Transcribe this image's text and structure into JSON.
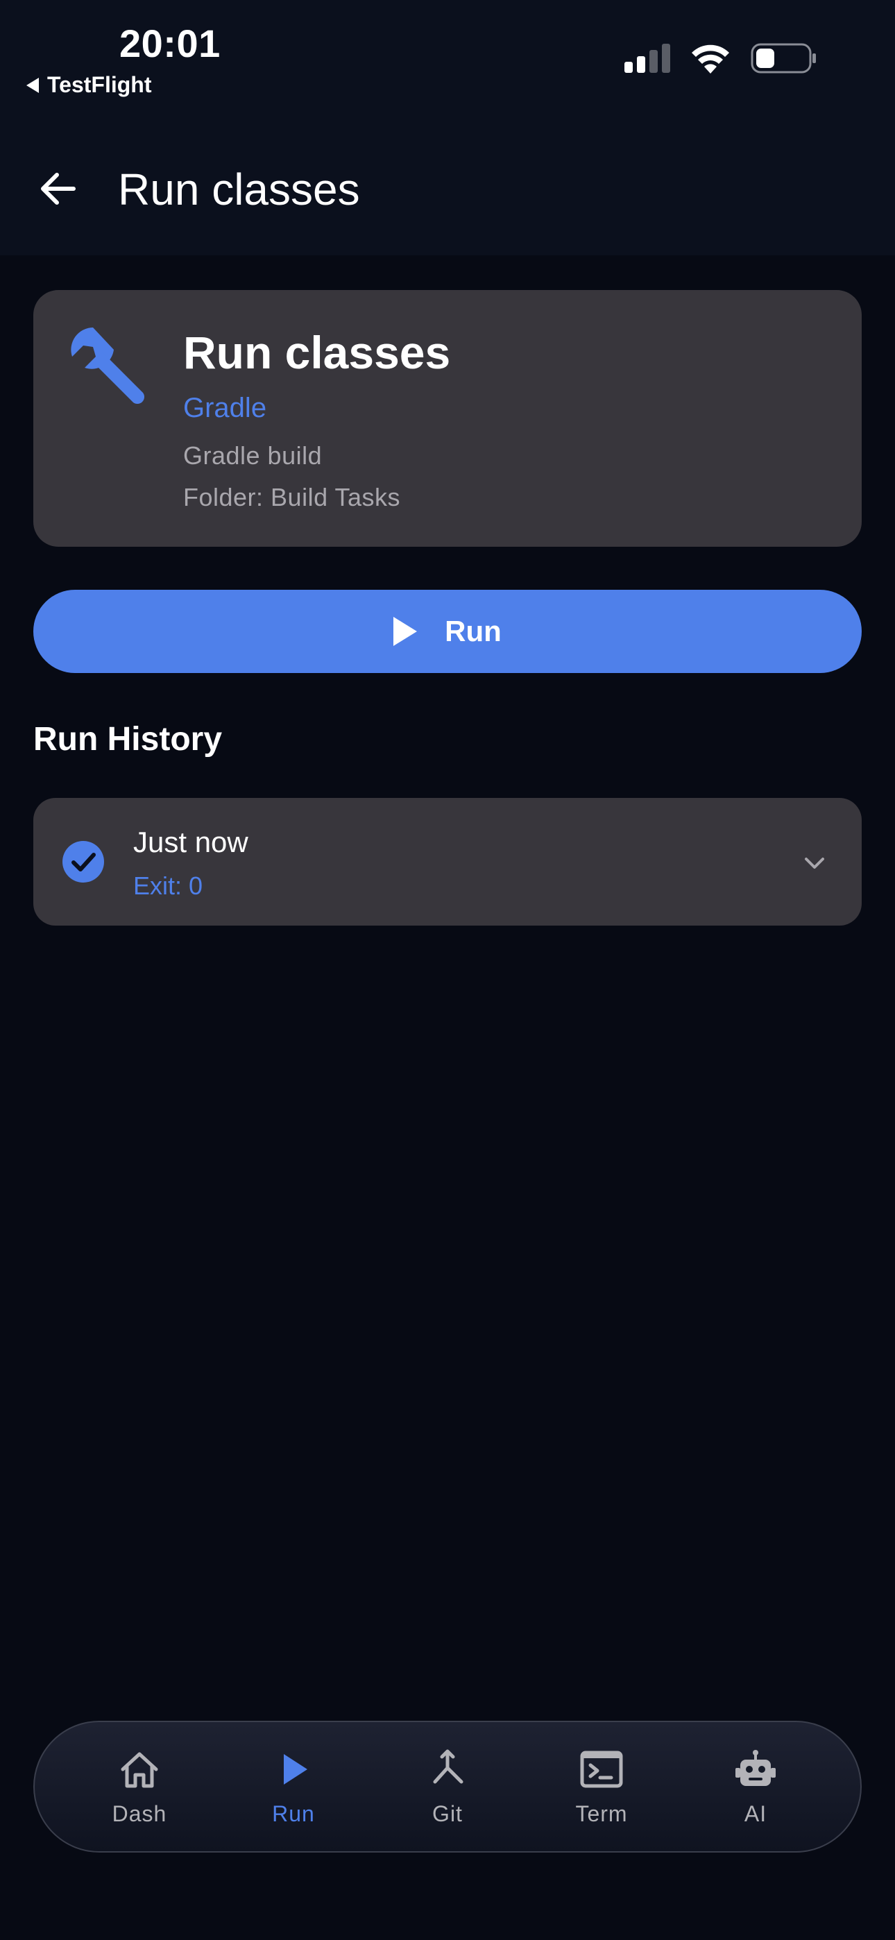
{
  "status_bar": {
    "time": "20:01",
    "back_app_label": "TestFlight"
  },
  "app_bar": {
    "title": "Run classes",
    "back_icon": "arrow-left-icon"
  },
  "task": {
    "icon": "wrench-icon",
    "name": "Run classes",
    "type": "Gradle",
    "description": "Gradle build",
    "folder": "Folder: Build Tasks"
  },
  "run_button": {
    "label": "Run",
    "icon": "play-icon"
  },
  "history": {
    "title": "Run History",
    "items": [
      {
        "time": "Just now",
        "exit": "Exit: 0",
        "status": "success",
        "icon": "check-circle-icon"
      }
    ]
  },
  "bottom_nav": {
    "items": [
      {
        "label": "Dash",
        "icon": "home-icon",
        "active": false
      },
      {
        "label": "Run",
        "icon": "play-icon",
        "active": true
      },
      {
        "label": "Git",
        "icon": "merge-icon",
        "active": false
      },
      {
        "label": "Term",
        "icon": "terminal-icon",
        "active": false
      },
      {
        "label": "AI",
        "icon": "robot-icon",
        "active": false
      }
    ]
  },
  "colors": {
    "accent": "#4f80ea",
    "background": "#070a14",
    "card": "#38363c",
    "muted_text": "#a9a7ad"
  }
}
